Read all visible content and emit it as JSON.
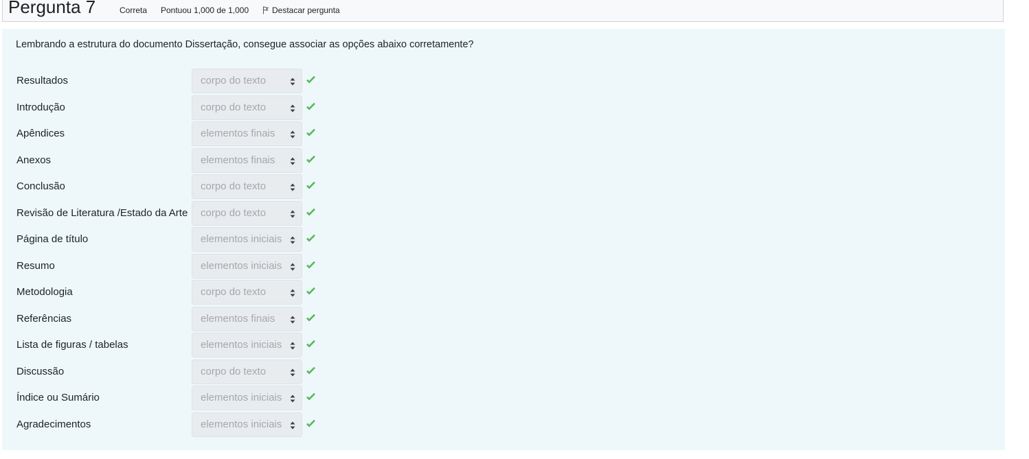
{
  "header": {
    "title": "Pergunta 7",
    "status": "Correta",
    "score": "Pontuou 1,000 de 1,000",
    "flag_label": "Destacar pergunta"
  },
  "question": {
    "text": "Lembrando a estrutura do documento Dissertação, consegue associar as opções abaixo corretamente?"
  },
  "rows": [
    {
      "label": "Resultados",
      "value": "corpo do texto"
    },
    {
      "label": "Introdução",
      "value": "corpo do texto"
    },
    {
      "label": "Apêndices",
      "value": "elementos finais"
    },
    {
      "label": "Anexos",
      "value": "elementos finais"
    },
    {
      "label": "Conclusão",
      "value": "corpo do texto"
    },
    {
      "label": "Revisão de Literatura /Estado da Arte",
      "value": "corpo do texto"
    },
    {
      "label": "Página de título",
      "value": "elementos iniciais"
    },
    {
      "label": "Resumo",
      "value": "elementos iniciais"
    },
    {
      "label": "Metodologia",
      "value": "corpo do texto"
    },
    {
      "label": "Referências",
      "value": "elementos finais"
    },
    {
      "label": "Lista de figuras / tabelas",
      "value": "elementos iniciais"
    },
    {
      "label": "Discussão",
      "value": "corpo do texto"
    },
    {
      "label": "Índice ou Sumário",
      "value": "elementos iniciais"
    },
    {
      "label": "Agradecimentos",
      "value": "elementos iniciais"
    }
  ],
  "colors": {
    "panel_background": "#eef8fb",
    "correct_check": "#5cb85c",
    "select_background": "#e9ecef",
    "select_text": "#a3a8ad"
  },
  "icons": {
    "correct": "check-icon",
    "flag": "flag-icon",
    "select_arrows": "sort-arrows-icon"
  }
}
